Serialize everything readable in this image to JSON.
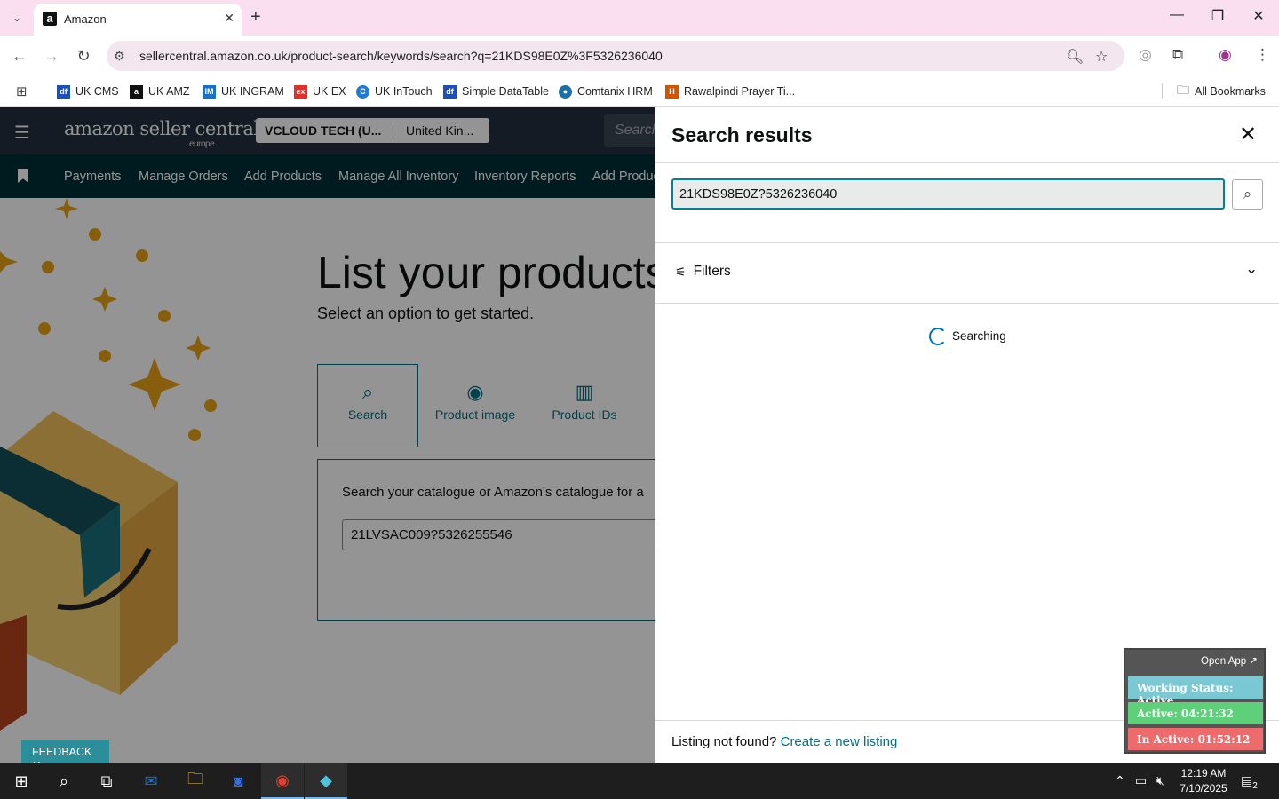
{
  "browser": {
    "tab_title": "Amazon",
    "tab_favicon": "a",
    "url": "sellercentral.amazon.co.uk/product-search/keywords/search?q=21KDS98E0Z%3F5326236040",
    "bookmarks": [
      {
        "label": "UK CMS",
        "icon_color": "#1e4fb5",
        "icon_text": "df"
      },
      {
        "label": "UK AMZ",
        "icon_color": "#111111",
        "icon_text": "a"
      },
      {
        "label": "UK INGRAM",
        "icon_color": "#1a6fc7",
        "icon_text": "IM"
      },
      {
        "label": "UK EX",
        "icon_color": "#e0322b",
        "icon_text": "ex"
      },
      {
        "label": "UK InTouch",
        "icon_color": "#1d7bd8",
        "icon_text": "C"
      },
      {
        "label": "Simple DataTable",
        "icon_color": "#1e4fb5",
        "icon_text": "df"
      },
      {
        "label": "Comtanix HRM",
        "icon_color": "#1d6fa8",
        "icon_text": "●"
      },
      {
        "label": "Rawalpindi Prayer Ti...",
        "icon_color": "#d35400",
        "icon_text": "H"
      }
    ],
    "all_bookmarks": "All Bookmarks"
  },
  "seller_central": {
    "logo": "amazon seller central",
    "logo_sub": "europe",
    "account_name": "VCLOUD TECH (U...",
    "account_region": "United Kin...",
    "search_placeholder": "Search",
    "nav": [
      "Payments",
      "Manage Orders",
      "Add Products",
      "Manage All Inventory",
      "Inventory Reports",
      "Add Produc"
    ],
    "hero_title": "List your products",
    "hero_subtitle": "Select an option to get started.",
    "options": [
      {
        "label": "Search",
        "icon": "search-icon"
      },
      {
        "label": "Product image",
        "icon": "camera-icon"
      },
      {
        "label": "Product IDs",
        "icon": "barcode-icon"
      }
    ],
    "panel_text": "Search your catalogue or Amazon's catalogue for a",
    "panel_input_value": "21LVSAC009?5326255546",
    "feedback": "FEEDBACK"
  },
  "sheet": {
    "title": "Search results",
    "search_value": "21KDS98E0Z?5326236040",
    "filters_label": "Filters",
    "status": "Searching",
    "footer_text": "Listing not found?",
    "footer_link": "Create a new listing"
  },
  "widget": {
    "open_app": "Open App ↗",
    "rows": [
      {
        "text": "Working Status: Active",
        "color": "#7ac8d4"
      },
      {
        "text": "Active: 04:21:32",
        "color": "#5fd07a"
      },
      {
        "text": "In Active: 01:52:12",
        "color": "#ef6b6b"
      }
    ]
  },
  "taskbar": {
    "time": "12:19 AM",
    "date": "7/10/2025",
    "notifications": "2"
  }
}
